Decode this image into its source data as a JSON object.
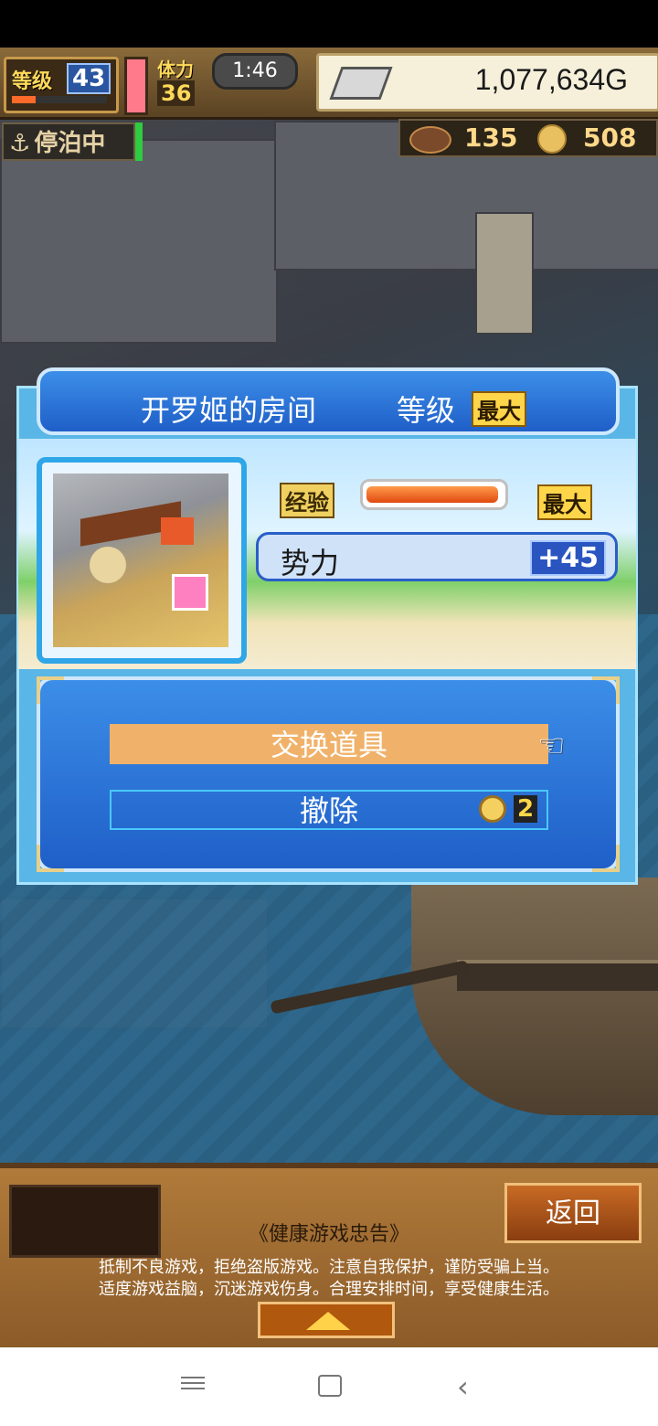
{
  "hud": {
    "level_label": "等级",
    "level_value": "43",
    "stamina_label": "体力",
    "stamina_value": "36",
    "time": "1:46",
    "money": "1,077,634G",
    "anchor_status": "停泊中",
    "resource1_value": "135",
    "resource2_value": "508"
  },
  "dialog": {
    "room_name": "开罗姬的房间",
    "level_label": "等级",
    "level_max": "最大",
    "exp_label": "经验",
    "exp_fill": 0.97,
    "exp_max": "最大",
    "power_label": "势力",
    "power_value": "+45",
    "exchange_label": "交换道具",
    "remove_label": "撤除",
    "remove_cost": "2"
  },
  "bottom": {
    "back_label": "返回",
    "notice_title": "《健康游戏忠告》",
    "notice_line1": "抵制不良游戏，拒绝盗版游戏。注意自我保护，谨防受骗上当。",
    "notice_line2": "适度游戏益脑，沉迷游戏伤身。合理安排时间，享受健康生活。"
  },
  "icons": {
    "anchor": "anchor-icon",
    "hand": "pointing-hand-icon",
    "coin": "coin-icon",
    "silver": "silver-bar-icon"
  }
}
